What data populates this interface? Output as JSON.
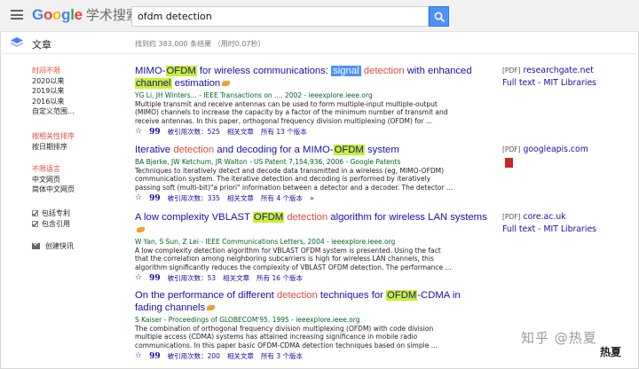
{
  "header": {
    "logo_letters": [
      "G",
      "o",
      "o",
      "g",
      "l",
      "e"
    ],
    "logo_suffix": "学术搜索",
    "search_value": "ofdm detection",
    "search_icon": "search-icon"
  },
  "subheader": {
    "section_label": "文章",
    "result_count": "找到约 383,000 条结果 （用时0.07秒）"
  },
  "sidebar": {
    "time_filters": [
      "时间不限",
      "2020以来",
      "2019以来",
      "2016以来",
      "自定义范围..."
    ],
    "sort_options": [
      "按相关性排序",
      "按日期排序"
    ],
    "language_options": [
      "不限语言",
      "中文网页",
      "简体中文网页"
    ],
    "checkboxes": [
      "包括专利",
      "包含引用"
    ],
    "create_alert": "创建快讯"
  },
  "results": [
    {
      "title_parts": [
        "MIMO-",
        "OFDM",
        " for wireless communications: ",
        "signal",
        " ",
        "detection",
        " with enhanced ",
        "channel",
        " estimation"
      ],
      "authors": "YG Li, JH Winters... - IEEE Transactions on ..., 2002 - ieeexplore.ieee.org",
      "snippet": [
        "Multiple transmit and receive antennas can be used to form multiple-input multiple-output",
        "(MIMO) channels to increase the capacity by a factor of the minimum number of transmit and",
        "receive antennas. In this paper, orthogonal frequency division multiplexing (OFDM) for ..."
      ],
      "cited_by": "被引用次数：525",
      "related": "相关文章",
      "versions": "所有 13 个版本"
    },
    {
      "title_parts": [
        "Iterative ",
        "detection",
        " and decoding for a MIMO-",
        "OFDM",
        " system"
      ],
      "authors": "BA Bjerke, JW Ketchum, JR Walton - US Patent 7,154,936, 2006 - Google Patents",
      "snippet": [
        "Techniques to iteratively detect and decode data transmitted in a wireless (eg, MIMO-OFDM)",
        "communication system. The iterative detection and decoding is performed by iteratively",
        "passing soft (multi-bit)\"a priori\" information between a detector and a decoder. The detector ..."
      ],
      "cited_by": "被引用次数：335",
      "related": "相关文章",
      "versions": "所有 4 个版本"
    },
    {
      "title_parts": [
        "A low complexity VBLAST ",
        "OFDM",
        " ",
        "detection",
        " algorithm for wireless LAN systems"
      ],
      "authors": "W Yan, S Sun, Z Lei - IEEE Communications Letters, 2004 - ieeexplore.ieee.org",
      "snippet": [
        "A low complexity detection algorithm for VBLAST OFDM system is presented. Using the fact",
        "that the correlation among neighboring subcarriers is high for wireless LAN channels, this",
        "algorithm significantly reduces the complexity of VBLAST OFDM detection. The performance ..."
      ],
      "cited_by": "被引用次数：53",
      "related": "相关文章",
      "versions": "所有 16 个版本"
    },
    {
      "title_parts": [
        "On the performance of different ",
        "detection",
        " techniques for ",
        "OFDM",
        "-CDMA in fading channels"
      ],
      "authors": "S Kaiser - Proceedings of GLOBECOM'95, 1995 - ieeexplore.ieee.org",
      "snippet": [
        "The combination of orthogonal frequency division multiplexing (OFDM) with code division",
        "multiple access (CDMA) systems has attained increasing significance in mobile radio",
        "communications. In this paper basic OFDM-CDMA detection techniques based on simple ..."
      ],
      "cited_by": "被引用次数：200",
      "related": "相关文章",
      "versions": "所有 3 个版本"
    }
  ],
  "right_links": [
    {
      "format": "[PDF]",
      "text": "researchgate.net"
    },
    {
      "format": "",
      "text": "Full text - MIT Libraries"
    },
    {
      "format": "[PDF]",
      "text": "googleapis.com"
    },
    {
      "format": "[PDF]",
      "text": "core.ac.uk"
    },
    {
      "format": "",
      "text": "Full text - MIT Libraries"
    }
  ],
  "watermark": "知乎 @热夏",
  "seal_text": "热夏",
  "colors": {
    "link": "#1a0dab",
    "green": "#006621",
    "red": "#dd4b39",
    "highlight": "#c6f22a",
    "blue_highlight": "#4d90fe"
  }
}
